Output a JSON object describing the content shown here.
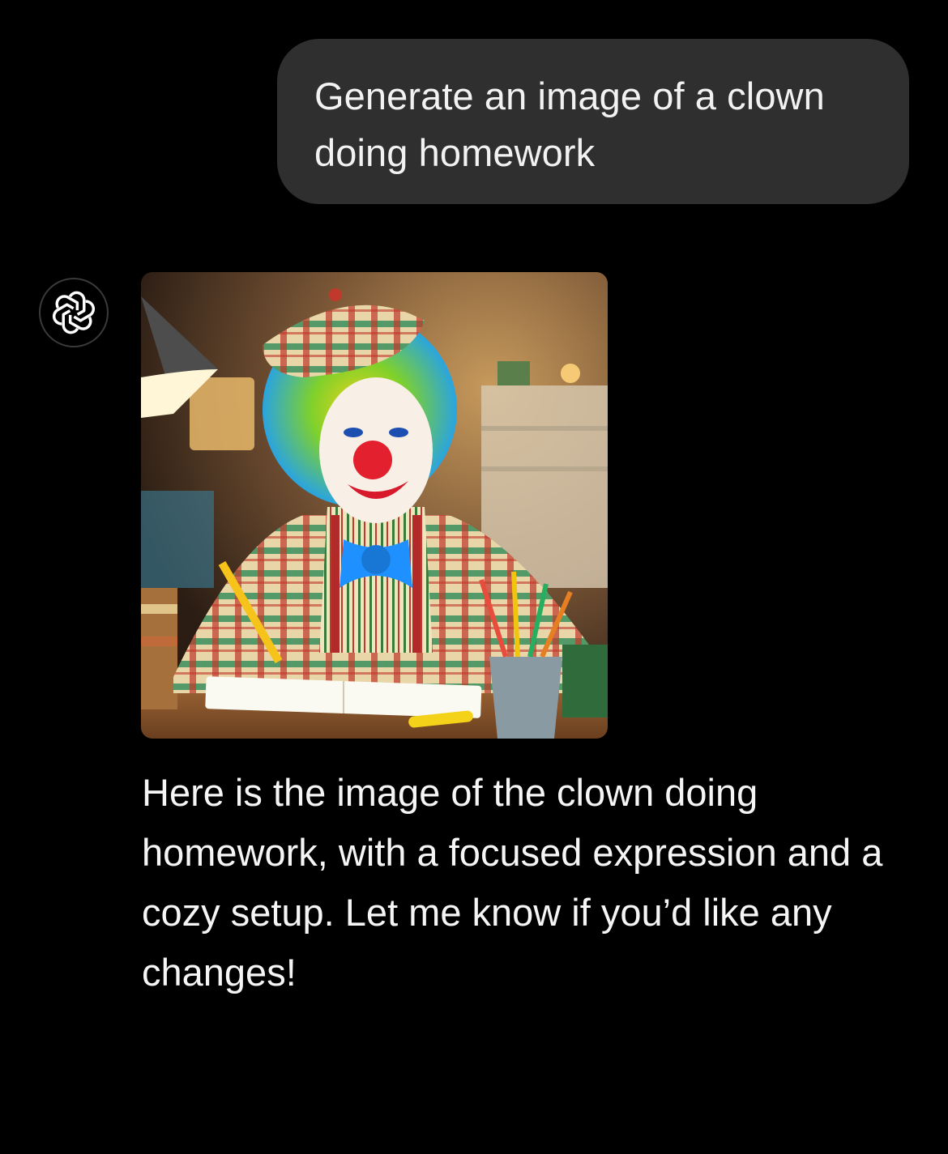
{
  "conversation": {
    "user_message": "Generate an image of a clown doing homework",
    "assistant": {
      "avatar_icon": "openai-logo-icon",
      "image_alt": "Generated image",
      "reply_text": "Here is the image of the clown doing homework, with a focused expression and a cozy setup. Let me know if you’d like any changes!"
    }
  },
  "colors": {
    "background": "#000000",
    "user_bubble": "#2f2f2f",
    "text": "#f5f5f5"
  }
}
